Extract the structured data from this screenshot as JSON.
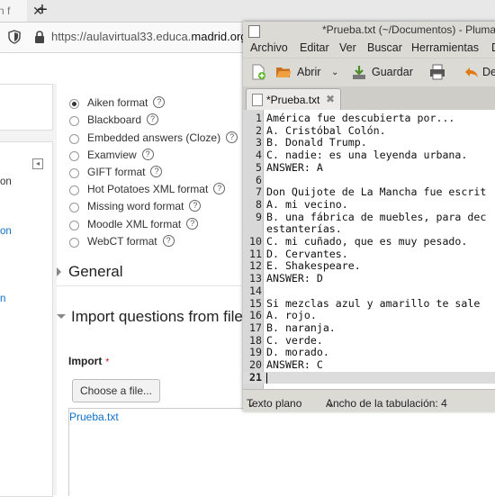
{
  "browser": {
    "tab_title_fragment": "n f",
    "url_prefix": "https://aulavirtual33.educa.",
    "url_domain": "madrid.org"
  },
  "sidebar": {
    "frag1": "on",
    "frag2": "on",
    "frag3": "n"
  },
  "form": {
    "formats": [
      {
        "label": "Aiken format",
        "selected": true
      },
      {
        "label": "Blackboard",
        "selected": false
      },
      {
        "label": "Embedded answers (Cloze)",
        "selected": false
      },
      {
        "label": "Examview",
        "selected": false
      },
      {
        "label": "GIFT format",
        "selected": false
      },
      {
        "label": "Hot Potatoes XML format",
        "selected": false
      },
      {
        "label": "Missing word format",
        "selected": false
      },
      {
        "label": "Moodle XML format",
        "selected": false
      },
      {
        "label": "WebCT format",
        "selected": false
      }
    ],
    "help_glyph": "?",
    "section_general": "General",
    "section_import": "Import questions from file",
    "import_label": "Import",
    "required_mark": "*",
    "choose_button": "Choose a file...",
    "file_name": "Prueba.txt"
  },
  "gedit": {
    "title": "*Prueba.txt (~/Documentos) - Pluma",
    "menu": [
      "Archivo",
      "Editar",
      "Ver",
      "Buscar",
      "Herramientas",
      "D"
    ],
    "toolbar": {
      "open": "Abrir",
      "save": "Guardar",
      "undo": "De"
    },
    "tab_name": "*Prueba.txt",
    "tab_close": "✖",
    "lines": [
      {
        "n": "1",
        "text": "América fue descubierta por..."
      },
      {
        "n": "2",
        "text": "A. Cristóbal Colón."
      },
      {
        "n": "3",
        "text": "B. Donald Trump."
      },
      {
        "n": "4",
        "text": "C. nadie: es una leyenda urbana."
      },
      {
        "n": "5",
        "text": "ANSWER: A"
      },
      {
        "n": "6",
        "text": ""
      },
      {
        "n": "7",
        "text": "Don Quijote de La Mancha fue escrit"
      },
      {
        "n": "8",
        "text": "A. mi vecino."
      },
      {
        "n": "9",
        "text": "B. una fábrica de muebles, para dec"
      },
      {
        "n": "",
        "text": "estanterías."
      },
      {
        "n": "10",
        "text": "C. mi cuñado, que es muy pesado."
      },
      {
        "n": "11",
        "text": "D. Cervantes."
      },
      {
        "n": "12",
        "text": "E. Shakespeare."
      },
      {
        "n": "13",
        "text": "ANSWER: D"
      },
      {
        "n": "14",
        "text": ""
      },
      {
        "n": "15",
        "text": "Si mezclas azul y amarillo te sale"
      },
      {
        "n": "16",
        "text": "A. rojo."
      },
      {
        "n": "17",
        "text": "B. naranja."
      },
      {
        "n": "18",
        "text": "C. verde."
      },
      {
        "n": "19",
        "text": "D. morado."
      },
      {
        "n": "20",
        "text": "ANSWER: C"
      },
      {
        "n": "21",
        "text": ""
      }
    ],
    "status": {
      "syntax": "Texto plano",
      "tab_width": "Ancho de la tabulación:  4"
    }
  }
}
